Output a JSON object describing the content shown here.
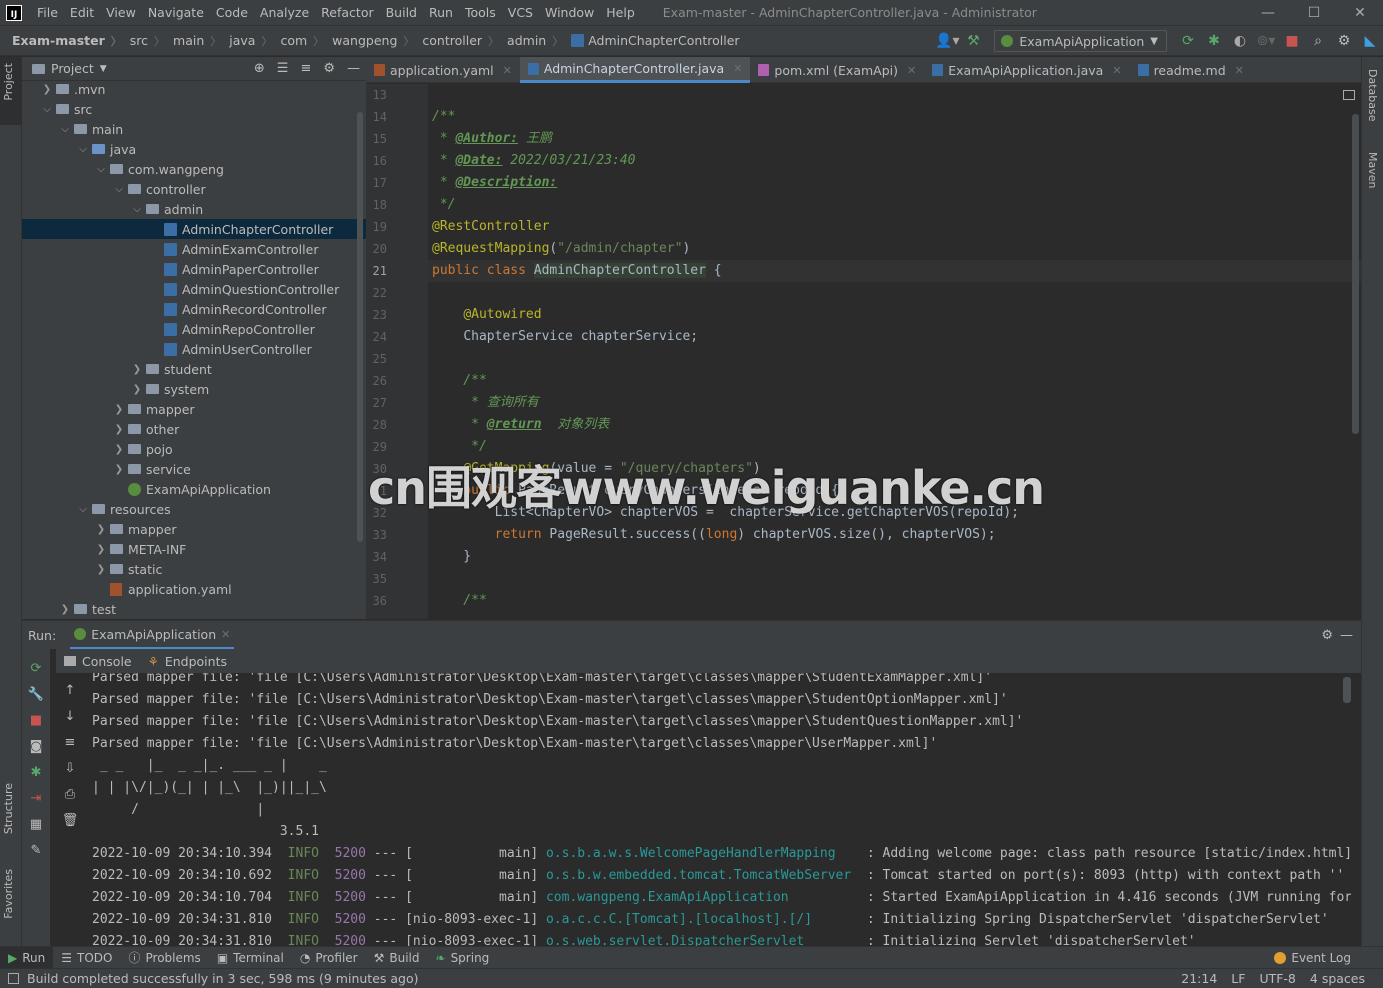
{
  "menubar": {
    "items": [
      "File",
      "Edit",
      "View",
      "Navigate",
      "Code",
      "Analyze",
      "Refactor",
      "Build",
      "Run",
      "Tools",
      "VCS",
      "Window",
      "Help"
    ],
    "window_title": "Exam-master - AdminChapterController.java - Administrator",
    "controls": [
      "—",
      "☐",
      "✕"
    ]
  },
  "breadcrumb": [
    "Exam-master",
    "src",
    "main",
    "java",
    "com",
    "wangpeng",
    "controller",
    "admin",
    "AdminChapterController"
  ],
  "run_config": "ExamApiApplication",
  "left_stripe": {
    "project": "Project",
    "structure": "Structure",
    "favorites": "Favorites"
  },
  "right_stripe": {
    "database": "Database",
    "maven": "Maven"
  },
  "project_panel": {
    "title": "Project",
    "tree": [
      {
        "label": ".mvn",
        "depth": 1,
        "arrow": "›",
        "icon": "folder"
      },
      {
        "label": "src",
        "depth": 1,
        "arrow": "⌄",
        "icon": "folder"
      },
      {
        "label": "main",
        "depth": 2,
        "arrow": "⌄",
        "icon": "folder"
      },
      {
        "label": "java",
        "depth": 3,
        "arrow": "⌄",
        "icon": "folder-blue"
      },
      {
        "label": "com.wangpeng",
        "depth": 4,
        "arrow": "⌄",
        "icon": "folder"
      },
      {
        "label": "controller",
        "depth": 5,
        "arrow": "⌄",
        "icon": "folder"
      },
      {
        "label": "admin",
        "depth": 6,
        "arrow": "⌄",
        "icon": "folder"
      },
      {
        "label": "AdminChapterController",
        "depth": 7,
        "arrow": "",
        "icon": "class",
        "selected": true
      },
      {
        "label": "AdminExamController",
        "depth": 7,
        "arrow": "",
        "icon": "class"
      },
      {
        "label": "AdminPaperController",
        "depth": 7,
        "arrow": "",
        "icon": "class"
      },
      {
        "label": "AdminQuestionController",
        "depth": 7,
        "arrow": "",
        "icon": "class"
      },
      {
        "label": "AdminRecordController",
        "depth": 7,
        "arrow": "",
        "icon": "class"
      },
      {
        "label": "AdminRepoController",
        "depth": 7,
        "arrow": "",
        "icon": "class"
      },
      {
        "label": "AdminUserController",
        "depth": 7,
        "arrow": "",
        "icon": "class"
      },
      {
        "label": "student",
        "depth": 6,
        "arrow": "›",
        "icon": "folder"
      },
      {
        "label": "system",
        "depth": 6,
        "arrow": "›",
        "icon": "folder"
      },
      {
        "label": "mapper",
        "depth": 5,
        "arrow": "›",
        "icon": "folder"
      },
      {
        "label": "other",
        "depth": 5,
        "arrow": "›",
        "icon": "folder"
      },
      {
        "label": "pojo",
        "depth": 5,
        "arrow": "›",
        "icon": "folder"
      },
      {
        "label": "service",
        "depth": 5,
        "arrow": "›",
        "icon": "folder"
      },
      {
        "label": "ExamApiApplication",
        "depth": 5,
        "arrow": "",
        "icon": "spring"
      },
      {
        "label": "resources",
        "depth": 3,
        "arrow": "⌄",
        "icon": "folder"
      },
      {
        "label": "mapper",
        "depth": 4,
        "arrow": "›",
        "icon": "folder"
      },
      {
        "label": "META-INF",
        "depth": 4,
        "arrow": "›",
        "icon": "folder"
      },
      {
        "label": "static",
        "depth": 4,
        "arrow": "›",
        "icon": "folder"
      },
      {
        "label": "application.yaml",
        "depth": 4,
        "arrow": "",
        "icon": "yaml"
      },
      {
        "label": "test",
        "depth": 2,
        "arrow": "›",
        "icon": "folder"
      }
    ]
  },
  "editor_tabs": [
    {
      "label": "application.yaml",
      "color": "#a0522d"
    },
    {
      "label": "AdminChapterController.java",
      "color": "#3a6ea5",
      "active": true
    },
    {
      "label": "pom.xml (ExamApi)",
      "color": "#b060b0"
    },
    {
      "label": "ExamApiApplication.java",
      "color": "#3a6ea5"
    },
    {
      "label": "readme.md",
      "color": "#3a6ea5"
    }
  ],
  "code": {
    "line_numbers": [
      "13",
      "14",
      "15",
      "16",
      "17",
      "18",
      "19",
      "20",
      "21",
      "22",
      "23",
      "24",
      "25",
      "26",
      "27",
      "28",
      "29",
      "30",
      "31",
      "32",
      "33",
      "34",
      "35",
      "36"
    ],
    "current_line": "21",
    "author_label": "@Author:",
    "author": "王鹏",
    "date_label": "@Date:",
    "date": "2022/03/21/23:40",
    "desc_label": "@Description:",
    "rest_controller": "@RestController",
    "request_mapping": "@RequestMapping",
    "mapping_path": "\"/admin/chapter\"",
    "class_name": "AdminChapterController",
    "autowired": "@Autowired",
    "field": "ChapterService chapterService;",
    "query_all": "查询所有",
    "return_tag": "@return",
    "return_desc": "对象列表",
    "get_mapping": "@GetMapping",
    "get_path": "\"/query/chapters\"",
    "method_sig": "PageResult queryChapters(Integer repoId){",
    "line32": "List<ChapterVO> chapterVOS =  chapterService.getChapterVOS(repoId);",
    "line33a": "PageResult.success((",
    "line33b": "long",
    "line33c": ") chapterVOS.size(), chapterVOS);"
  },
  "watermark": "cn围观客www.weiguanke.cn",
  "run_panel": {
    "label": "Run:",
    "config_tab": "ExamApiApplication",
    "subtabs": [
      "Console",
      "Endpoints"
    ],
    "console_lines": [
      "Parsed mapper file: 'file [C:\\Users\\Administrator\\Desktop\\Exam-master\\target\\classes\\mapper\\StudentExamMapper.xml]'",
      "Parsed mapper file: 'file [C:\\Users\\Administrator\\Desktop\\Exam-master\\target\\classes\\mapper\\StudentOptionMapper.xml]'",
      "Parsed mapper file: 'file [C:\\Users\\Administrator\\Desktop\\Exam-master\\target\\classes\\mapper\\StudentQuestionMapper.xml]'",
      "Parsed mapper file: 'file [C:\\Users\\Administrator\\Desktop\\Exam-master\\target\\classes\\mapper\\UserMapper.xml]'",
      " _ _   |_  _ _|_. ___ _ |    _",
      "| | |\\/|_)(_| | |_\\  |_)||_|_\\",
      "     /               |",
      "                        3.5.1"
    ],
    "log_lines": [
      {
        "ts": "2022-10-09 20:34:10.394",
        "lvl": "INFO",
        "pid": "5200",
        "mid": " --- [           main] ",
        "logger": "o.s.b.a.w.s.WelcomePageHandlerMapping   ",
        "msg": " : Adding welcome page: class path resource [static/index.html]"
      },
      {
        "ts": "2022-10-09 20:34:10.692",
        "lvl": "INFO",
        "pid": "5200",
        "mid": " --- [           main] ",
        "logger": "o.s.b.w.embedded.tomcat.TomcatWebServer ",
        "msg": " : Tomcat started on port(s): 8093 (http) with context path ''"
      },
      {
        "ts": "2022-10-09 20:34:10.704",
        "lvl": "INFO",
        "pid": "5200",
        "mid": " --- [           main] ",
        "logger": "com.wangpeng.ExamApiApplication         ",
        "msg": " : Started ExamApiApplication in 4.416 seconds (JVM running for"
      },
      {
        "ts": "2022-10-09 20:34:31.810",
        "lvl": "INFO",
        "pid": "5200",
        "mid": " --- [nio-8093-exec-1] ",
        "logger": "o.a.c.c.C.[Tomcat].[localhost].[/]      ",
        "msg": " : Initializing Spring DispatcherServlet 'dispatcherServlet'"
      },
      {
        "ts": "2022-10-09 20:34:31.810",
        "lvl": "INFO",
        "pid": "5200",
        "mid": " --- [nio-8093-exec-1] ",
        "logger": "o.s.web.servlet.DispatcherServlet       ",
        "msg": " : Initializing Servlet 'dispatcherServlet'"
      }
    ]
  },
  "bottom_tools": [
    "Run",
    "TODO",
    "Problems",
    "Terminal",
    "Profiler",
    "Build",
    "Spring"
  ],
  "event_log": "Event Log",
  "status": {
    "message": "Build completed successfully in 3 sec, 598 ms (9 minutes ago)",
    "position": "21:14",
    "line_sep": "LF",
    "encoding": "UTF-8",
    "indent": "4 spaces"
  },
  "colors": {
    "accent": "#4a88c7",
    "selection": "#0d293e",
    "keyword": "#cc7832",
    "annotation": "#bbb529",
    "string": "#6a8759",
    "doc": "#629755"
  }
}
